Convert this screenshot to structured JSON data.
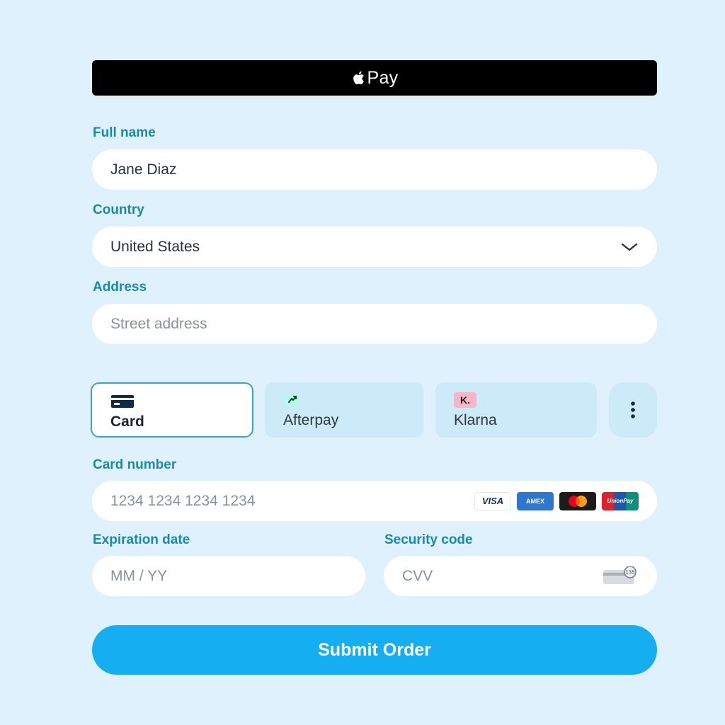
{
  "apple_pay": {
    "label": "Pay",
    "logo_icon": "apple-logo-icon"
  },
  "form": {
    "full_name": {
      "label": "Full name",
      "value": "Jane Diaz"
    },
    "country": {
      "label": "Country",
      "value": "United States",
      "icon": "chevron-down-icon"
    },
    "address": {
      "label": "Address",
      "placeholder": "Street address"
    }
  },
  "payment_tabs": [
    {
      "label": "Card",
      "icon": "credit-card-icon",
      "active": true
    },
    {
      "label": "Afterpay",
      "icon": "afterpay-icon",
      "active": false
    },
    {
      "label": "Klarna",
      "icon": "klarna-icon",
      "badge": "K.",
      "active": false
    }
  ],
  "more_icon": "more-vertical-icon",
  "card": {
    "number": {
      "label": "Card number",
      "placeholder": "1234 1234 1234 1234"
    },
    "brands": [
      "VISA",
      "AMEX",
      "Mastercard",
      "UnionPay"
    ],
    "brand_labels": {
      "visa": "VISA",
      "amex": "AMEX",
      "unionpay": "UnionPay"
    },
    "expiry": {
      "label": "Expiration date",
      "placeholder": "MM / YY"
    },
    "cvc": {
      "label": "Security code",
      "placeholder": "CVV",
      "icon": "cvc-card-icon",
      "icon_text": "135"
    }
  },
  "submit": {
    "label": "Submit Order"
  },
  "colors": {
    "background": "#def1fd",
    "label": "#1a8ba7",
    "submit": "#15aef0",
    "tab_active_border": "#35a6c9"
  }
}
